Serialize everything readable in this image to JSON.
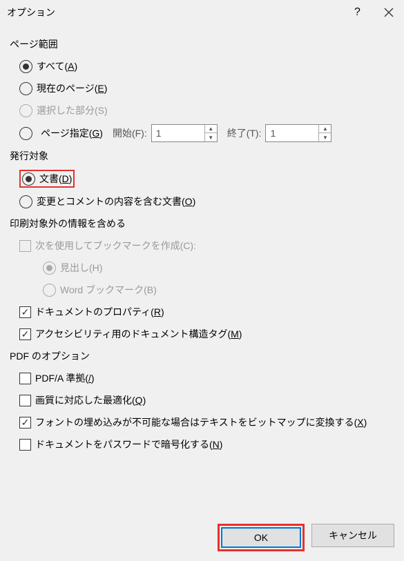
{
  "title": "オプション",
  "sections": {
    "pageRange": {
      "label": "ページ範囲",
      "all": "すべて(",
      "allKey": "A",
      "current": "現在のページ(",
      "currentKey": "E",
      "selection": "選択した部分(S)",
      "pages": "ページ指定(",
      "pagesKey": "G",
      "from": "開始(F):",
      "to": "終了(T):",
      "fromValue": "1",
      "toValue": "1"
    },
    "publish": {
      "label": "発行対象",
      "document": "文書(",
      "documentKey": "D",
      "documentWithMarkup": "変更とコメントの内容を含む文書(",
      "documentWithMarkupKey": "O"
    },
    "nonPrinting": {
      "label": "印刷対象外の情報を含める",
      "createBookmarks": "次を使用してブックマークを作成(C):",
      "headings": "見出し(H)",
      "wordBookmarks": "Word ブックマーク(B)",
      "docProps": "ドキュメントのプロパティ(",
      "docPropsKey": "R",
      "accessibility": "アクセシビリティ用のドキュメント構造タグ(",
      "accessibilityKey": "M"
    },
    "pdf": {
      "label": "PDF のオプション",
      "pdfa": "PDF/A 準拠(",
      "pdfaKey": "/",
      "optimize": "画質に対応した最適化(",
      "optimizeKey": "Q",
      "bitmap": "フォントの埋め込みが不可能な場合はテキストをビットマップに変換する(",
      "bitmapKey": "X",
      "encrypt": "ドキュメントをパスワードで暗号化する(",
      "encryptKey": "N"
    }
  },
  "buttons": {
    "ok": "OK",
    "cancel": "キャンセル"
  },
  "close": ")"
}
